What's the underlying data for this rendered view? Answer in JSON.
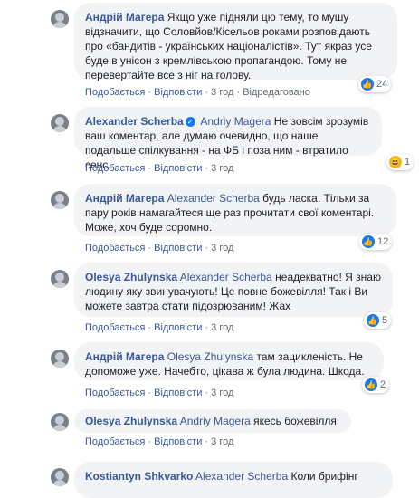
{
  "actions": {
    "like": "Подобається",
    "reply": "Відповісти",
    "edited": "Відредаговано",
    "sep": "·"
  },
  "comments": [
    {
      "author": "Андрій Магера",
      "mention": "",
      "text": "Якщо уже підняли цю тему, то мушу відзначити, що Соловйов/Кісельов роками розповідають про «бандитів - українських націоналістів». Тут якраз усе буде в унісон з кремлівською пропагандою. Тому не перевертайте все з ніг на голову.",
      "time": "3 год",
      "edited": true,
      "reactions": {
        "type": "like-icon",
        "count": "24"
      }
    },
    {
      "author": "Alexander Scherba",
      "verified": true,
      "mention": "Andriy Magera",
      "text": "Не зовсім зрозумів ваш коментар, але думаю очевидно, що наше подальше спілкування - на ФБ і поза ним - втратило сенс.",
      "time": "3 год",
      "reactions": {
        "type": "haha-icon",
        "count": "1"
      }
    },
    {
      "author": "Андрій Магера",
      "mention": "Alexander Scherba",
      "text": "будь ласка. Тільки за пару років намагайтеся ще раз прочитати свої коментарі. Може, хоч буде соромно.",
      "time": "3 год",
      "reactions": {
        "type": "like-icon",
        "count": "12"
      }
    },
    {
      "author": "Olesya Zhulynska",
      "mention": "Alexander Scherba",
      "text": "неадекватно! Я знаю людину яку звинувачують! Це повне божевілля! Так і Ви можете завтра стати підозрюваним! Жах",
      "time": "3 год",
      "reactions": {
        "type": "like-icon",
        "count": "5"
      }
    },
    {
      "author": "Андрій Магера",
      "mention": "Olesya Zhulynska",
      "text": "там зацикленість. Не допоможе уже. Начебто, цікава ж була людина. Шкода.",
      "time": "3 год",
      "reactions": {
        "type": "like-icon",
        "count": "2"
      }
    },
    {
      "author": "Olesya Zhulynska",
      "mention": "Andriy Magera",
      "text": "якесь божевілля",
      "time": "3 год"
    },
    {
      "author": "Kostiantyn Shkvarko",
      "mention": "Alexander Scherba",
      "text": "Коли брифінг",
      "time": ""
    }
  ]
}
